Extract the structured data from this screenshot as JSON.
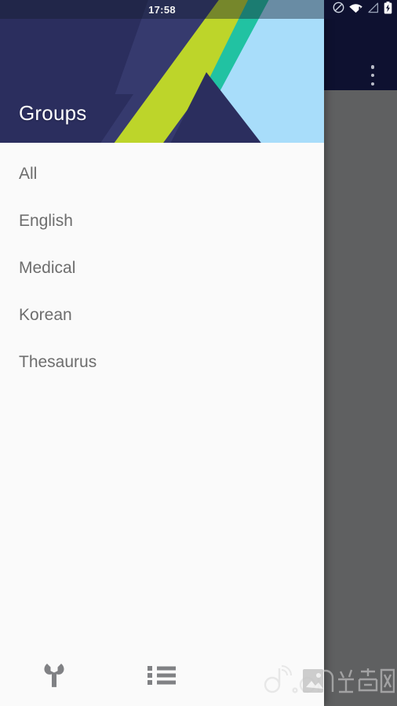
{
  "status_bar": {
    "clock": "17:58",
    "icons": [
      {
        "name": "do-not-disturb-icon",
        "glyph": "⃠"
      },
      {
        "name": "wifi-warning-icon",
        "glyph": "wifi"
      },
      {
        "name": "cellular-signal-icon",
        "glyph": "signal"
      },
      {
        "name": "battery-charging-icon",
        "glyph": "battery"
      }
    ],
    "tint_color": "#141c2e",
    "dark_color": "#0e1130"
  },
  "app_bar": {
    "background": "#0e1130",
    "overflow_menu_label": "More options"
  },
  "drawer": {
    "title": "Groups",
    "background": "#fafafa",
    "header": {
      "colors": {
        "navy": "#2b2e5e",
        "navy_light": "#363a6e",
        "lime": "#bdd52a",
        "teal": "#21c2a2",
        "sky": "#a8ddfa"
      }
    },
    "items": [
      {
        "label": "All"
      },
      {
        "label": "English"
      },
      {
        "label": "Medical"
      },
      {
        "label": "Korean"
      },
      {
        "label": "Thesaurus"
      }
    ],
    "bottom_bar": {
      "buttons": [
        {
          "name": "settings-wrench-button",
          "icon": "wrench-icon",
          "label": "Settings"
        },
        {
          "name": "list-view-button",
          "icon": "list-icon",
          "label": "List"
        }
      ]
    }
  },
  "watermark": {
    "text": "d.cn 当乐网"
  }
}
